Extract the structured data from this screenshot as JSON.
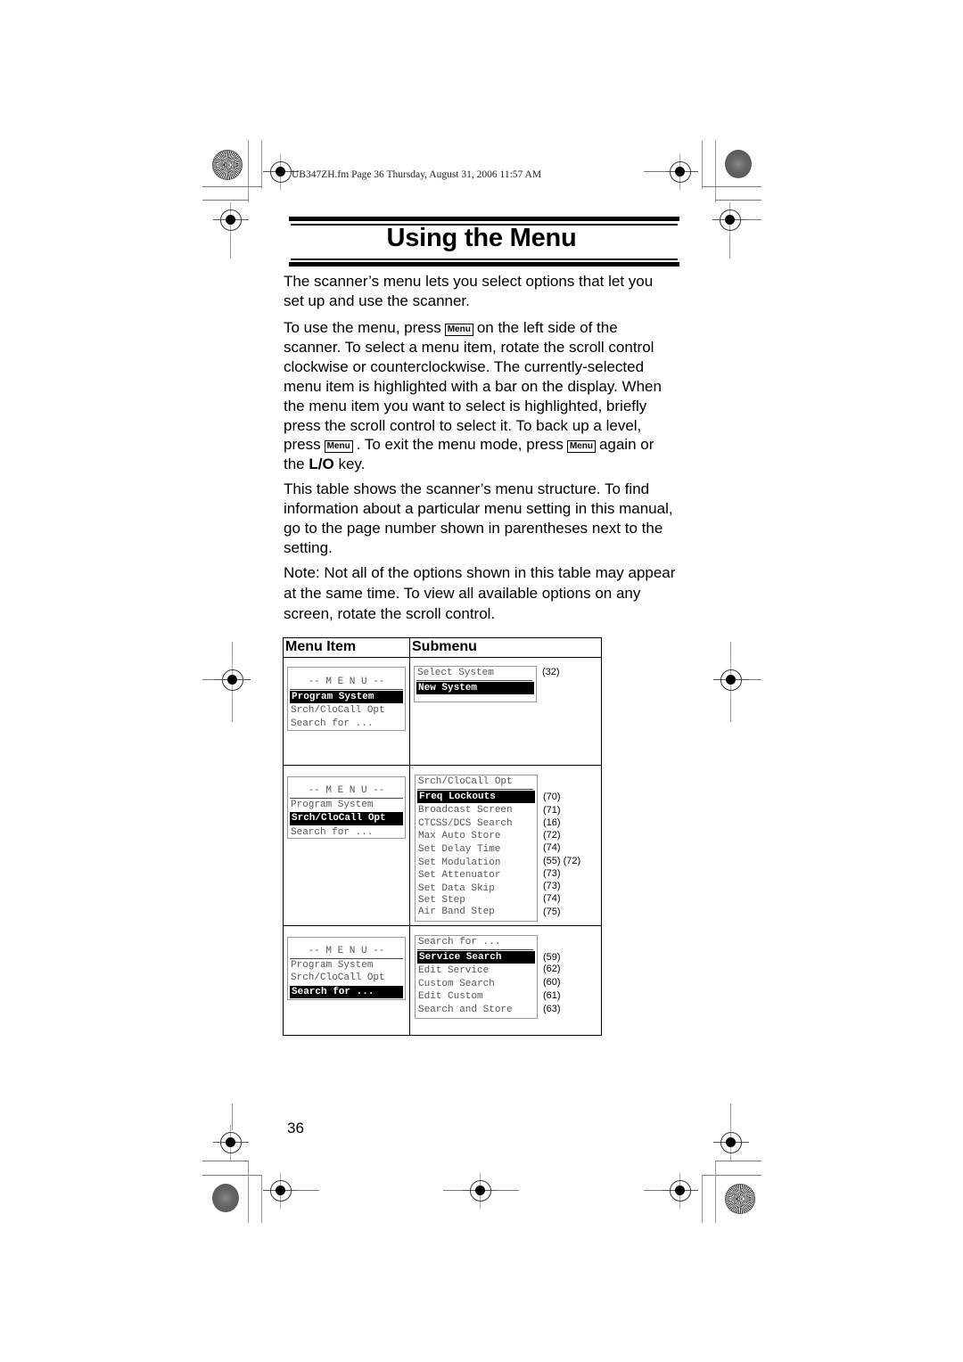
{
  "print_header": "UB347ZH.fm  Page 36  Thursday, August 31, 2006  11:57 AM",
  "title": "Using the Menu",
  "key_label": "Menu",
  "intro": "The scanner’s menu lets you select options that let you set up and use the scanner.",
  "usage": {
    "part1": "To use the menu, press",
    "part2": "on the left side of the scanner. To select a menu item, rotate the scroll control clockwise or counterclockwise. The currently-selected menu item is highlighted with a bar on the display. When the menu item you want to select is highlighted, briefly press the scroll control to select it. To back up a level, press",
    "part3": ". To exit the menu mode, press",
    "part4": "again or the",
    "key_lo": "L/O",
    "part5": "key."
  },
  "table_intro": "This table shows the scanner’s menu structure. To find information about a particular menu setting in this manual, go to the page number shown in parentheses next to the setting.",
  "note": "Note: Not all of the options shown in this table may appear at the same time. To view all available options on any screen, rotate the scroll control.",
  "table": {
    "headers": [
      "Menu Item",
      "Submenu"
    ],
    "menu_title": "-- M E N U --",
    "rows": [
      {
        "menu": [
          "Program System",
          "Srch/CloCall Opt",
          "Search for ..."
        ],
        "menu_selected": 0,
        "submenu_title": "Select System",
        "submenu_title_page": "(32)",
        "submenu": [
          {
            "label": "New System",
            "page": ""
          }
        ],
        "submenu_selected": 0
      },
      {
        "menu": [
          "Program System",
          "Srch/CloCall Opt",
          "Search for ..."
        ],
        "menu_selected": 1,
        "submenu_title": "Srch/CloCall Opt",
        "submenu_title_page": "",
        "submenu": [
          {
            "label": "Freq Lockouts",
            "page": "(70)"
          },
          {
            "label": "Broadcast Screen",
            "page": "(71)"
          },
          {
            "label": "CTCSS/DCS Search",
            "page": "(16)"
          },
          {
            "label": "Max Auto Store",
            "page": "(72)"
          },
          {
            "label": "Set Delay Time",
            "page": "(74)"
          },
          {
            "label": "Set Modulation",
            "page": "(55) (72)"
          },
          {
            "label": "Set Attenuator",
            "page": "(73)"
          },
          {
            "label": "Set Data Skip",
            "page": "(73)"
          },
          {
            "label": "Set Step",
            "page": "(74)"
          },
          {
            "label": "Air Band Step",
            "page": "(75)"
          }
        ],
        "submenu_selected": 0
      },
      {
        "menu": [
          "Program System",
          "Srch/CloCall Opt",
          "Search for ..."
        ],
        "menu_selected": 2,
        "submenu_title": "Search for ...",
        "submenu_title_page": "",
        "submenu": [
          {
            "label": "Service Search",
            "page": "(59)"
          },
          {
            "label": "Edit Service",
            "page": "(62)"
          },
          {
            "label": "Custom Search",
            "page": "(60)"
          },
          {
            "label": "Edit Custom",
            "page": "(61)"
          },
          {
            "label": "Search and Store",
            "page": "(63)"
          }
        ],
        "submenu_selected": 0
      }
    ]
  },
  "page_number": "36"
}
